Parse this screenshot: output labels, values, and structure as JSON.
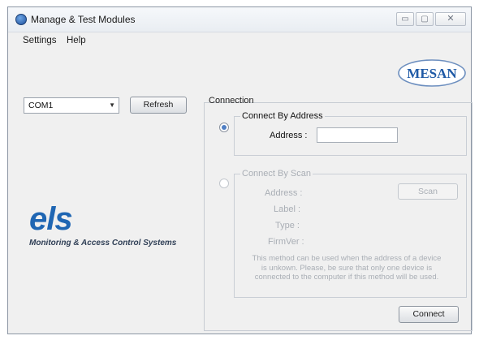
{
  "window": {
    "title": "Manage & Test Modules",
    "controls": {
      "minimize": "▭",
      "maximize": "▢",
      "close": "✕"
    }
  },
  "menu": {
    "items": [
      "Settings",
      "Help"
    ]
  },
  "branding": {
    "mesan_logo_text": "MESAN",
    "els_logo_text": "els",
    "els_tagline": "Monitoring & Access Control Systems",
    "els_color": "#1f66b3",
    "mesan_color": "#1f5aa6"
  },
  "port": {
    "selected": "COM1",
    "refresh_label": "Refresh"
  },
  "connection": {
    "group_label": "Connection",
    "by_address": {
      "label": "Connect By Address",
      "selected": true,
      "address_label": "Address :",
      "address_value": ""
    },
    "by_scan": {
      "label": "Connect By Scan",
      "selected": false,
      "fields": [
        "Address :",
        "Label :",
        "Type :",
        "FirmVer :"
      ],
      "scan_label": "Scan",
      "note_lines": [
        "This method can be used when the address of a device",
        "is unkown. Please, be sure that only one device is",
        "connected to the computer if this method will be used."
      ]
    },
    "connect_label": "Connect"
  }
}
